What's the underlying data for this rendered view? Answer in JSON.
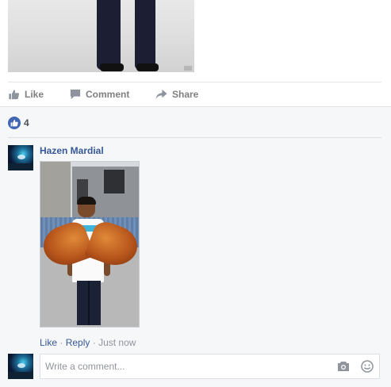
{
  "post": {
    "actions": {
      "like_label": "Like",
      "comment_label": "Comment",
      "share_label": "Share"
    }
  },
  "reactions": {
    "count": "4",
    "icon": "thumbs-up-icon",
    "color": "#4267b2"
  },
  "comment": {
    "author": "Hazen Mardial",
    "like_label": "Like",
    "separator": "·",
    "reply_label": "Reply",
    "timestamp": "Just now"
  },
  "composer": {
    "placeholder": "Write a comment...",
    "camera_icon": "camera-icon",
    "emoji_icon": "emoji-icon"
  },
  "colors": {
    "link": "#365899",
    "muted": "#90949c",
    "action": "#7f7f7f",
    "panel_bg": "#f6f7f9"
  }
}
